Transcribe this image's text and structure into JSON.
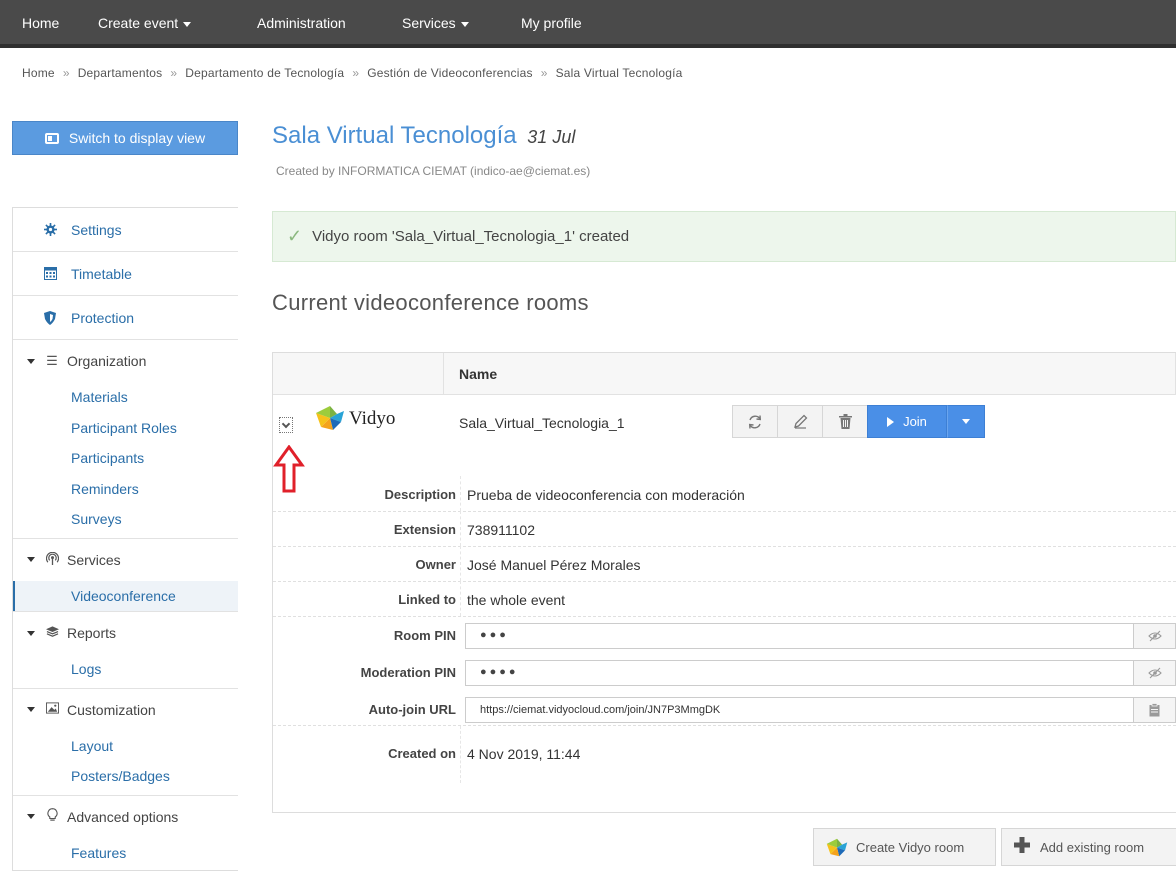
{
  "topnav": {
    "items": [
      {
        "label": "Home",
        "dropdown": false
      },
      {
        "label": "Create event",
        "dropdown": true
      },
      {
        "label": "Administration",
        "dropdown": false
      },
      {
        "label": "Services",
        "dropdown": true
      },
      {
        "label": "My profile",
        "dropdown": false
      }
    ]
  },
  "breadcrumb": [
    "Home",
    "Departamentos",
    "Departamento de Tecnología",
    "Gestión de Videoconferencias",
    "Sala Virtual Tecnología"
  ],
  "breadcrumb_separator": "»",
  "display_view_button": "Switch to display view",
  "sidebar": {
    "top_items": [
      {
        "label": "Settings",
        "icon": "gear-icon"
      },
      {
        "label": "Timetable",
        "icon": "calendar-icon"
      },
      {
        "label": "Protection",
        "icon": "shield-icon"
      }
    ],
    "sections": [
      {
        "label": "Organization",
        "icon": "list-icon",
        "items": [
          "Materials",
          "Participant Roles",
          "Participants",
          "Reminders",
          "Surveys"
        ]
      },
      {
        "label": "Services",
        "icon": "broadcast-icon",
        "items": [
          "Videoconference"
        ],
        "active": "Videoconference"
      },
      {
        "label": "Reports",
        "icon": "layers-icon",
        "items": [
          "Logs"
        ]
      },
      {
        "label": "Customization",
        "icon": "image-icon",
        "items": [
          "Layout",
          "Posters/Badges"
        ]
      },
      {
        "label": "Advanced options",
        "icon": "lightbulb-icon",
        "items": [
          "Features"
        ]
      }
    ]
  },
  "event": {
    "title": "Sala Virtual Tecnología",
    "date": "31 Jul",
    "created_by": "Created by INFORMATICA CIEMAT (indico-ae@ciemat.es)"
  },
  "alert": {
    "message": "Vidyo room 'Sala_Virtual_Tecnologia_1' created",
    "icon": "check-icon"
  },
  "section_title": "Current videoconference rooms",
  "table": {
    "column_name": "Name",
    "room": {
      "provider": "Vidyo",
      "name": "Sala_Virtual_Tecnologia_1",
      "join_label": "Join"
    },
    "details": [
      {
        "label": "Description",
        "value": "Prueba de videoconferencia con moderación"
      },
      {
        "label": "Extension",
        "value": "738911102"
      },
      {
        "label": "Owner",
        "value": "José Manuel Pérez Morales"
      },
      {
        "label": "Linked to",
        "value": "the whole event"
      }
    ],
    "room_pin": {
      "label": "Room PIN",
      "masked": "●●●"
    },
    "moderation_pin": {
      "label": "Moderation PIN",
      "masked": "●●●●"
    },
    "auto_join": {
      "label": "Auto-join URL",
      "value": "https://ciemat.vidyocloud.com/join/JN7P3MmgDK"
    },
    "created_on": {
      "label": "Created on",
      "value": "4 Nov 2019, 11:44"
    }
  },
  "buttons": {
    "create_room": "Create Vidyo room",
    "add_existing": "Add existing room"
  },
  "colors": {
    "nav_bg": "#4a4a4a",
    "accent": "#4a8fd4",
    "join": "#4a8fe7",
    "alert_bg": "#edf6ec",
    "annotation_arrow": "#e0202a"
  }
}
